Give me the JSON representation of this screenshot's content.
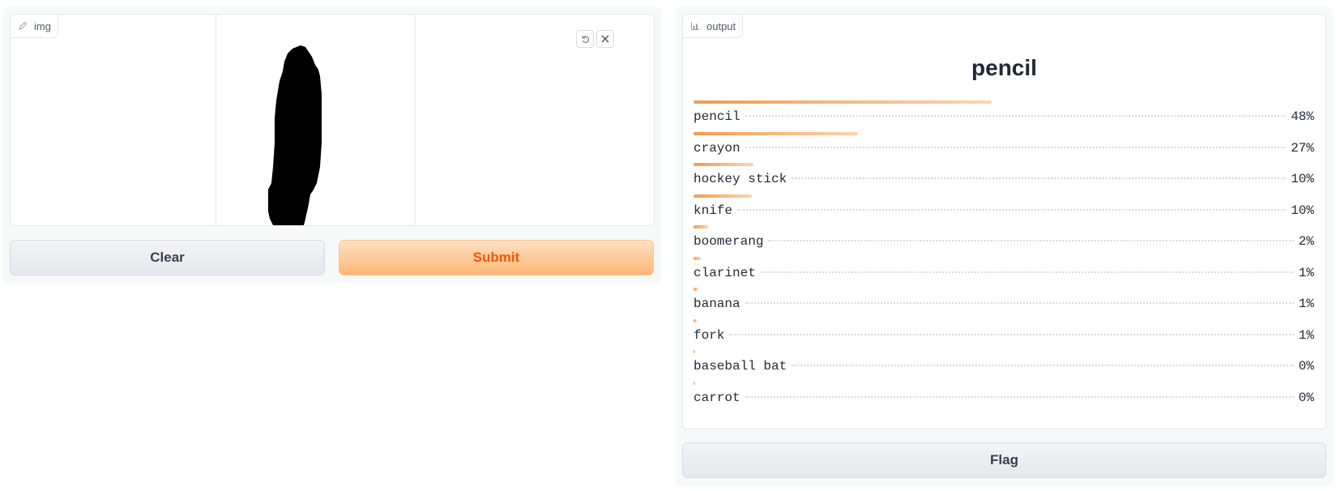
{
  "input": {
    "tag_label": "img",
    "tag_icon": "pencil-icon",
    "tools": {
      "undo_icon": "undo-icon",
      "close_icon": "close-icon"
    }
  },
  "buttons": {
    "clear": "Clear",
    "submit": "Submit",
    "flag": "Flag"
  },
  "output": {
    "tag_label": "output",
    "tag_icon": "bar-chart-icon",
    "label": "pencil",
    "confidences": [
      {
        "label": "pencil",
        "value": 0.48,
        "text": "48%"
      },
      {
        "label": "crayon",
        "value": 0.265,
        "text": "27%"
      },
      {
        "label": "hockey stick",
        "value": 0.097,
        "text": "10%"
      },
      {
        "label": "knife",
        "value": 0.094,
        "text": "10%"
      },
      {
        "label": "boomerang",
        "value": 0.024,
        "text": "2%"
      },
      {
        "label": "clarinet",
        "value": 0.012,
        "text": "1%"
      },
      {
        "label": "banana",
        "value": 0.007,
        "text": "1%"
      },
      {
        "label": "fork",
        "value": 0.005,
        "text": "1%"
      },
      {
        "label": "baseball bat",
        "value": 0.003,
        "text": "0%"
      },
      {
        "label": "carrot",
        "value": 0.001,
        "text": "0%"
      }
    ]
  },
  "colors": {
    "primary_text": "#ea580c",
    "bar_start": "#f59a4c",
    "bar_end": "#fdd5ab"
  }
}
